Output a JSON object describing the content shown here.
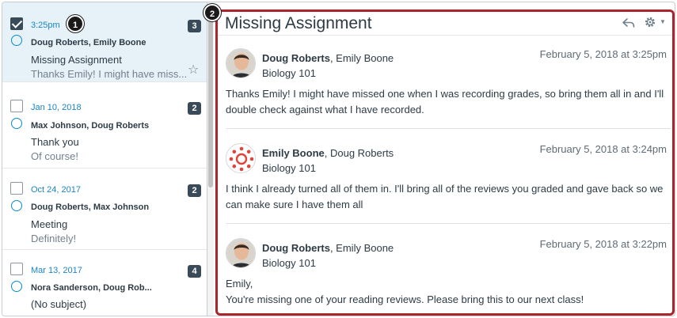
{
  "callouts": {
    "one": "1",
    "two": "2"
  },
  "conversations": [
    {
      "date": "3:25pm",
      "names": "Doug Roberts, Emily Boone",
      "subject": "Missing Assignment",
      "preview": "Thanks Emily! I might have miss...",
      "count": "3",
      "selected": true
    },
    {
      "date": "Jan 10, 2018",
      "names": "Max Johnson, Doug Roberts",
      "subject": "Thank you",
      "preview": "Of course!",
      "count": "2"
    },
    {
      "date": "Oct 24, 2017",
      "names": "Doug Roberts, Max Johnson",
      "subject": "Meeting",
      "preview": "Definitely!",
      "count": "2"
    },
    {
      "date": "Mar 13, 2017",
      "names": "Nora Sanderson, Doug Rob...",
      "subject": "(No subject)",
      "preview": "",
      "count": "4"
    }
  ],
  "thread": {
    "title": "Missing Assignment",
    "messages": [
      {
        "author": "Doug Roberts",
        "others": ", Emily Boone",
        "course": "Biology 101",
        "date": "February 5, 2018 at 3:25pm",
        "avatar": "doug-photo",
        "body": "Thanks Emily! I might have missed one when I was recording grades, so bring them all in and I'll double check against what I have recorded."
      },
      {
        "author": "Emily Boone",
        "others": ", Doug Roberts",
        "course": "Biology 101",
        "date": "February 5, 2018 at 3:24pm",
        "avatar": "canvas-logo",
        "body": "I think I already turned all of them in. I'll bring all of the reviews you graded and gave back so we can make sure I have them all"
      },
      {
        "author": "Doug Roberts",
        "others": ", Emily Boone",
        "course": "Biology 101",
        "date": "February 5, 2018 at 3:22pm",
        "avatar": "doug-photo",
        "body_line1": "Emily,",
        "body_line2": "You're missing one of your reading reviews. Please bring this to our next class!"
      }
    ]
  },
  "colors": {
    "accent": "#1a85c8",
    "highlight_border": "#a8262c",
    "selected_bg": "#e6f1f8",
    "badge": "#394b58"
  }
}
